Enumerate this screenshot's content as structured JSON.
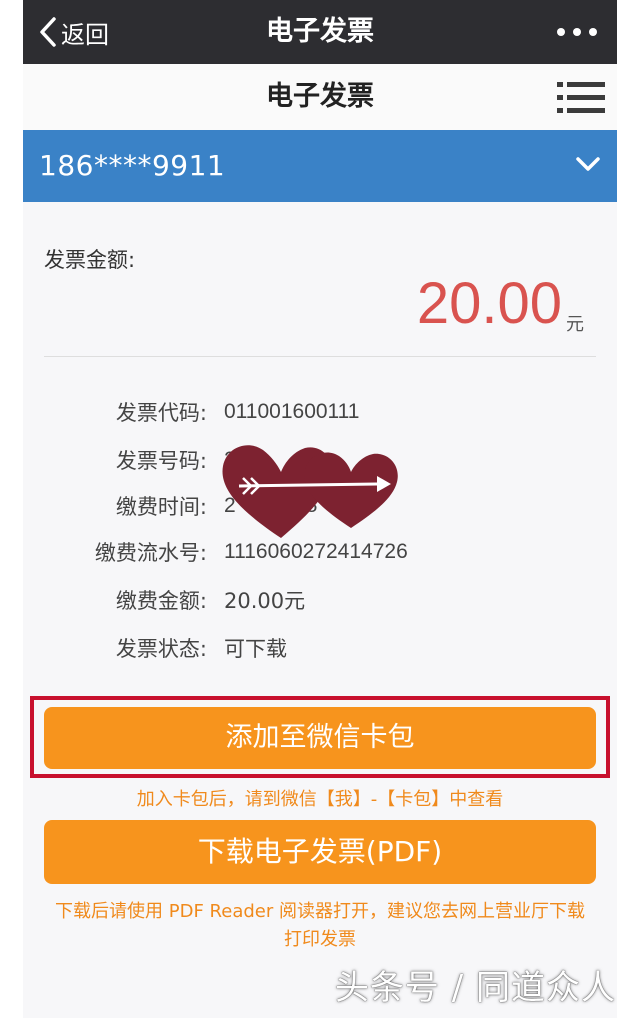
{
  "navbar": {
    "back_label": "返回",
    "title": "电子发票",
    "back_icon": "chevron-left-icon",
    "more_icon": "more-dots-icon"
  },
  "header": {
    "title": "电子发票",
    "menu_icon": "list-icon"
  },
  "account": {
    "number": "186****9911",
    "dropdown_icon": "chevron-down-icon"
  },
  "invoice": {
    "amount_label": "发票金额:",
    "amount": "20.00",
    "unit": "元",
    "details": [
      {
        "label": "发票代码:",
        "value": "011001600111"
      },
      {
        "label": "发票号码:",
        "value": "269"
      },
      {
        "label": "缴费时间:",
        "value": "2            8"
      },
      {
        "label": "缴费流水号:",
        "value": "1116060272414726"
      },
      {
        "label": "缴费金额:",
        "value": "20.00元"
      },
      {
        "label": "发票状态:",
        "value": "可下载"
      }
    ]
  },
  "actions": {
    "add_to_wallet": "添加至微信卡包",
    "add_hint": "加入卡包后，请到微信【我】-【卡包】中查看",
    "download": "下载电子发票(PDF)",
    "download_hint": "下载后请使用 PDF Reader 阅读器打开，建议您去网上营业厅下载打印发票"
  },
  "watermark": "头条号 / 同道众人",
  "colors": {
    "navbar": "#2d2d31",
    "account_bar": "#3a82c7",
    "amount": "#d9534f",
    "button": "#f7941d",
    "hint": "#f08a1c",
    "highlight_frame": "#c8102e",
    "sticker": "#7d2230"
  },
  "overlays": {
    "sticker_icon": "hearts-arrow-sticker-icon"
  }
}
